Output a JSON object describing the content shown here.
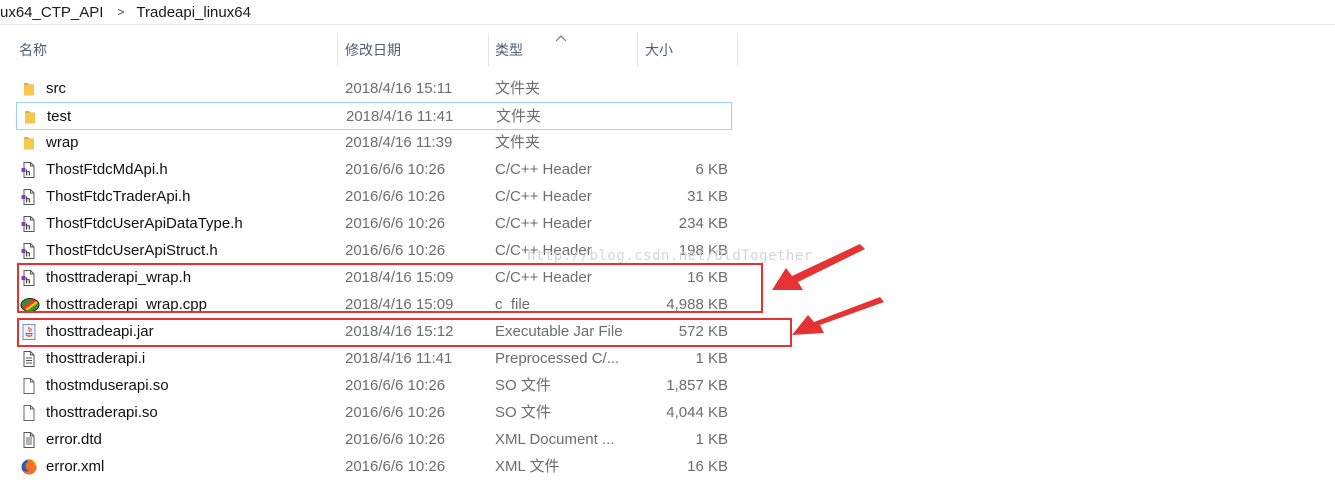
{
  "breadcrumb": {
    "items": [
      "ux64_CTP_API",
      "Tradeapi_linux64"
    ],
    "separator": ">"
  },
  "columns": {
    "name": "名称",
    "date": "修改日期",
    "type": "类型",
    "size": "大小"
  },
  "files": [
    {
      "name": "src",
      "date": "2018/4/16 15:11",
      "type": "文件夹",
      "size": "",
      "icon": "folder-icon"
    },
    {
      "name": "test",
      "date": "2018/4/16 11:41",
      "type": "文件夹",
      "size": "",
      "icon": "folder-icon",
      "focused": true
    },
    {
      "name": "wrap",
      "date": "2018/4/16 11:39",
      "type": "文件夹",
      "size": "",
      "icon": "folder-icon"
    },
    {
      "name": "ThostFtdcMdApi.h",
      "date": "2016/6/6 10:26",
      "type": "C/C++ Header",
      "size": "6 KB",
      "icon": "header-file-icon"
    },
    {
      "name": "ThostFtdcTraderApi.h",
      "date": "2016/6/6 10:26",
      "type": "C/C++ Header",
      "size": "31 KB",
      "icon": "header-file-icon"
    },
    {
      "name": "ThostFtdcUserApiDataType.h",
      "date": "2016/6/6 10:26",
      "type": "C/C++ Header",
      "size": "234 KB",
      "icon": "header-file-icon"
    },
    {
      "name": "ThostFtdcUserApiStruct.h",
      "date": "2016/6/6 10:26",
      "type": "C/C++ Header",
      "size": "198 KB",
      "icon": "header-file-icon"
    },
    {
      "name": "thosttraderapi_wrap.h",
      "date": "2018/4/16 15:09",
      "type": "C/C++ Header",
      "size": "16 KB",
      "icon": "header-file-icon"
    },
    {
      "name": "thosttraderapi_wrap.cpp",
      "date": "2018/4/16 15:09",
      "type": "c_file",
      "size": "4,988 KB",
      "icon": "cpp-file-icon"
    },
    {
      "name": "thosttradeapi.jar",
      "date": "2018/4/16 15:12",
      "type": "Executable Jar File",
      "size": "572 KB",
      "icon": "jar-file-icon"
    },
    {
      "name": "thosttraderapi.i",
      "date": "2018/4/16 11:41",
      "type": "Preprocessed C/...",
      "size": "1 KB",
      "icon": "text-file-icon"
    },
    {
      "name": "thostmduserapi.so",
      "date": "2016/6/6 10:26",
      "type": "SO 文件",
      "size": "1,857 KB",
      "icon": "blank-file-icon"
    },
    {
      "name": "thosttraderapi.so",
      "date": "2016/6/6 10:26",
      "type": "SO 文件",
      "size": "4,044 KB",
      "icon": "blank-file-icon"
    },
    {
      "name": "error.dtd",
      "date": "2016/6/6 10:26",
      "type": "XML Document ...",
      "size": "1 KB",
      "icon": "dtd-file-icon"
    },
    {
      "name": "error.xml",
      "date": "2016/6/6 10:26",
      "type": "XML 文件",
      "size": "16 KB",
      "icon": "firefox-icon"
    }
  ],
  "watermark": "http://blog.csdn.net/OldTogether",
  "colors": {
    "highlight": "#e53333",
    "header_text": "#4c607a",
    "focus_border": "#99d1ff"
  }
}
